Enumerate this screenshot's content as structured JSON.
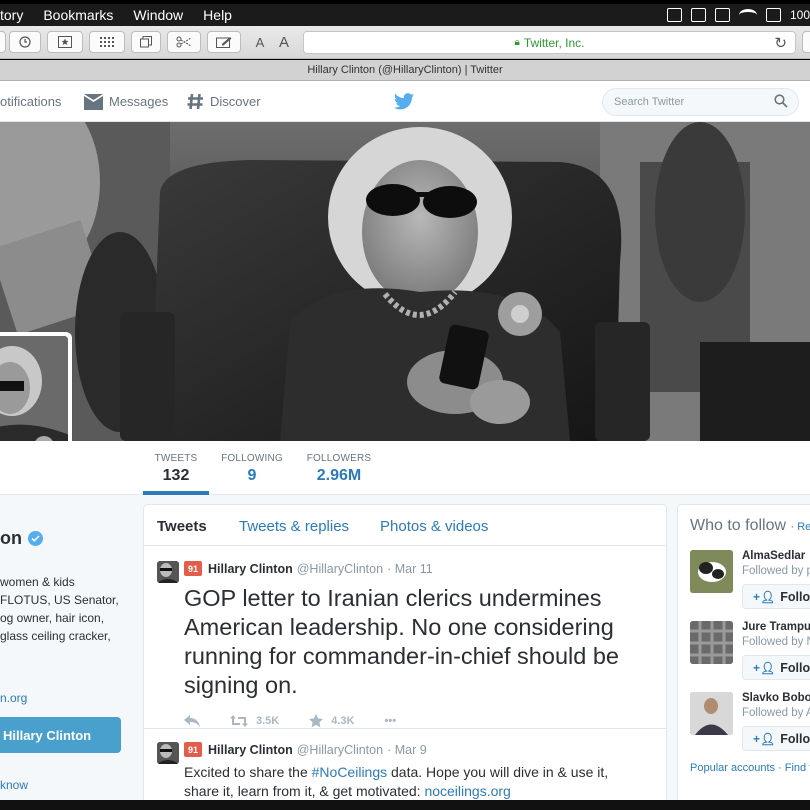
{
  "menubar": {
    "items": [
      "story",
      "Bookmarks",
      "Window",
      "Help"
    ],
    "battery_text": "100"
  },
  "toolbar": {
    "font_small": "A",
    "font_large": "A",
    "address": "Twitter, Inc."
  },
  "tab": {
    "title": "Hillary Clinton (@HillaryClinton) | Twitter"
  },
  "nav": {
    "notifications": "otifications",
    "messages": "Messages",
    "discover": "Discover",
    "search_placeholder": "Search Twitter"
  },
  "stats": {
    "tweets_label": "TWEETS",
    "tweets_value": "132",
    "following_label": "FOLLOWING",
    "following_value": "9",
    "followers_label": "FOLLOWERS",
    "followers_value": "2.96M"
  },
  "profile": {
    "name": "on",
    "bio_lines": [
      "women & kids",
      "FLOTUS, US Senator,",
      "og owner, hair icon,",
      "glass ceiling cracker,"
    ],
    "link": "n.org",
    "tweet_button": "Hillary Clinton",
    "know": "know"
  },
  "timeline": {
    "tabs": [
      "Tweets",
      "Tweets & replies",
      "Photos & videos"
    ],
    "tweets": [
      {
        "badge": "91",
        "name": "Hillary Clinton",
        "handle": "@HillaryClinton",
        "date": "· Mar 11",
        "text_lines": [
          "GOP letter to Iranian clerics undermines",
          "American leadership.  No one considering",
          "running for commander-in-chief should be",
          "signing on."
        ],
        "retweets": "3.5K",
        "favorites": "4.3K",
        "more": "•••"
      },
      {
        "badge": "91",
        "name": "Hillary Clinton",
        "handle": "@HillaryClinton",
        "date": "· Mar 9",
        "line1_pre": "Excited to share the ",
        "line1_link": "#NoCeilings",
        "line1_post": " data. Hope you will dive in & use it,",
        "line2_pre": "share it, learn from it, & get motivated: ",
        "line2_link": "noceilings.org"
      }
    ]
  },
  "who_to_follow": {
    "title": "Who to follow",
    "refresh": "· Refr",
    "items": [
      {
        "name": "AlmaSedlar",
        "sub": "Followed by p",
        "button": "Follow"
      },
      {
        "name": "Jure Trampu",
        "sub": "Followed by N",
        "button": "Follow"
      },
      {
        "name": "Slavko Bobo",
        "sub": "Followed by A",
        "button": "Follow"
      }
    ],
    "footer": "Popular accounts · Find f"
  },
  "colors": {
    "twitter_blue": "#55acee",
    "link_blue": "#2b7bb9",
    "address_green": "#2d9a32"
  }
}
